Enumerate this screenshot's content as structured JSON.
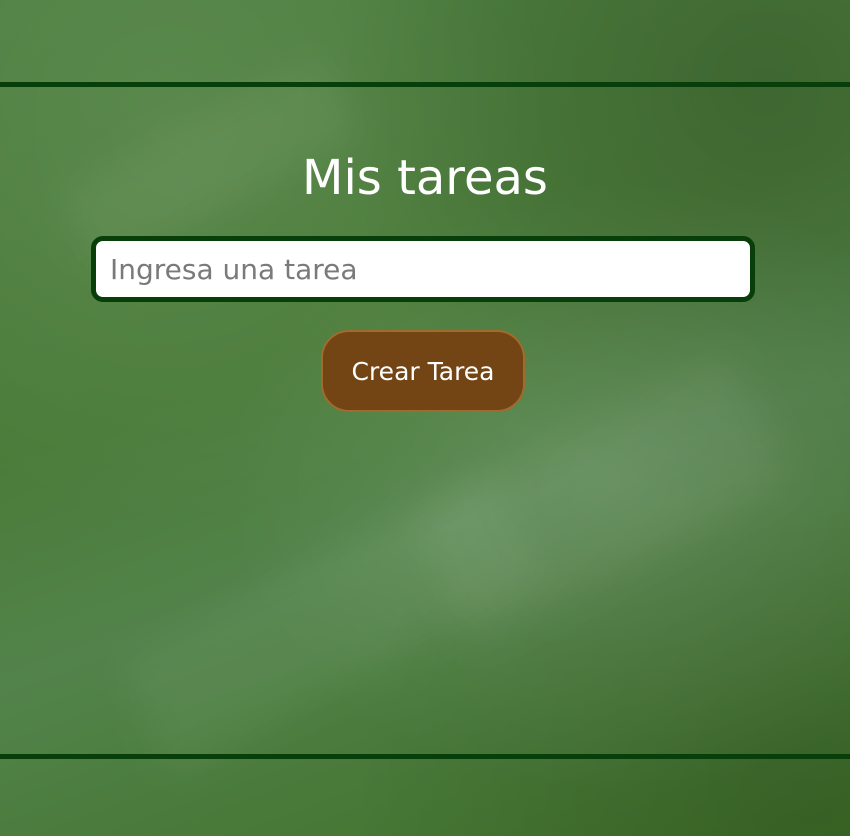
{
  "app": {
    "title": "Mis tareas"
  },
  "form": {
    "task_input_placeholder": "Ingresa una tarea",
    "task_input_value": "",
    "create_button_label": "Crear Tarea"
  },
  "colors": {
    "chalkboard_green": "#4a7c38",
    "rule_dark_green": "#083e0a",
    "input_border": "#083e0a",
    "button_brown": "#734414",
    "button_border": "#a26a2c",
    "text_white": "#ffffff"
  }
}
